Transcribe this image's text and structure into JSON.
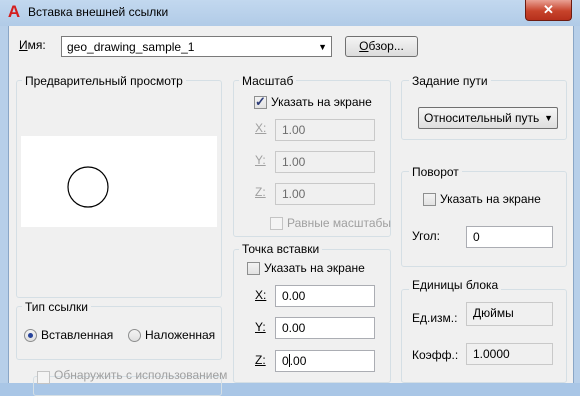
{
  "window": {
    "title": "Вставка внешней ссылки",
    "close_glyph": "✕"
  },
  "name_row": {
    "label_prefix": "И",
    "label_rest": "мя:",
    "value": "geo_drawing_sample_1",
    "browse_prefix": "О",
    "browse_rest": "бзор..."
  },
  "preview": {
    "title": "Предварительный просмотр"
  },
  "scale": {
    "title": "Масштаб",
    "specify_on_screen": "Указать на экране",
    "specify_checked": true,
    "x_label": "X:",
    "x_value": "1.00",
    "y_label": "Y:",
    "y_value": "1.00",
    "z_label": "Z:",
    "z_value": "1.00",
    "uniform_label": "Равные масштабы",
    "uniform_checked": false
  },
  "path": {
    "title": "Задание пути",
    "selected": "Относительный путь"
  },
  "rotation": {
    "title": "Поворот",
    "specify_on_screen": "Указать на экране",
    "specify_checked": false,
    "angle_label": "Угол:",
    "angle_value": "0"
  },
  "insertion": {
    "title": "Точка вставки",
    "specify_on_screen": "Указать на экране",
    "specify_checked": false,
    "x_label": "X:",
    "x_value": "0.00",
    "y_label": "Y:",
    "y_value": "0.00",
    "z_label": "Z:",
    "z_value_before_caret": "0",
    "z_value_after_caret": ".00"
  },
  "block_units": {
    "title": "Единицы блока",
    "unit_label": "Ед.изм.:",
    "unit_value": "Дюймы",
    "factor_label": "Коэфф.:",
    "factor_value": "1.0000"
  },
  "reference_type": {
    "title": "Тип ссылки",
    "attach_label": "Вставленная",
    "overlay_label": "Наложенная",
    "selected": "attach"
  },
  "locate": {
    "label": "Обнаружить с использованием"
  }
}
